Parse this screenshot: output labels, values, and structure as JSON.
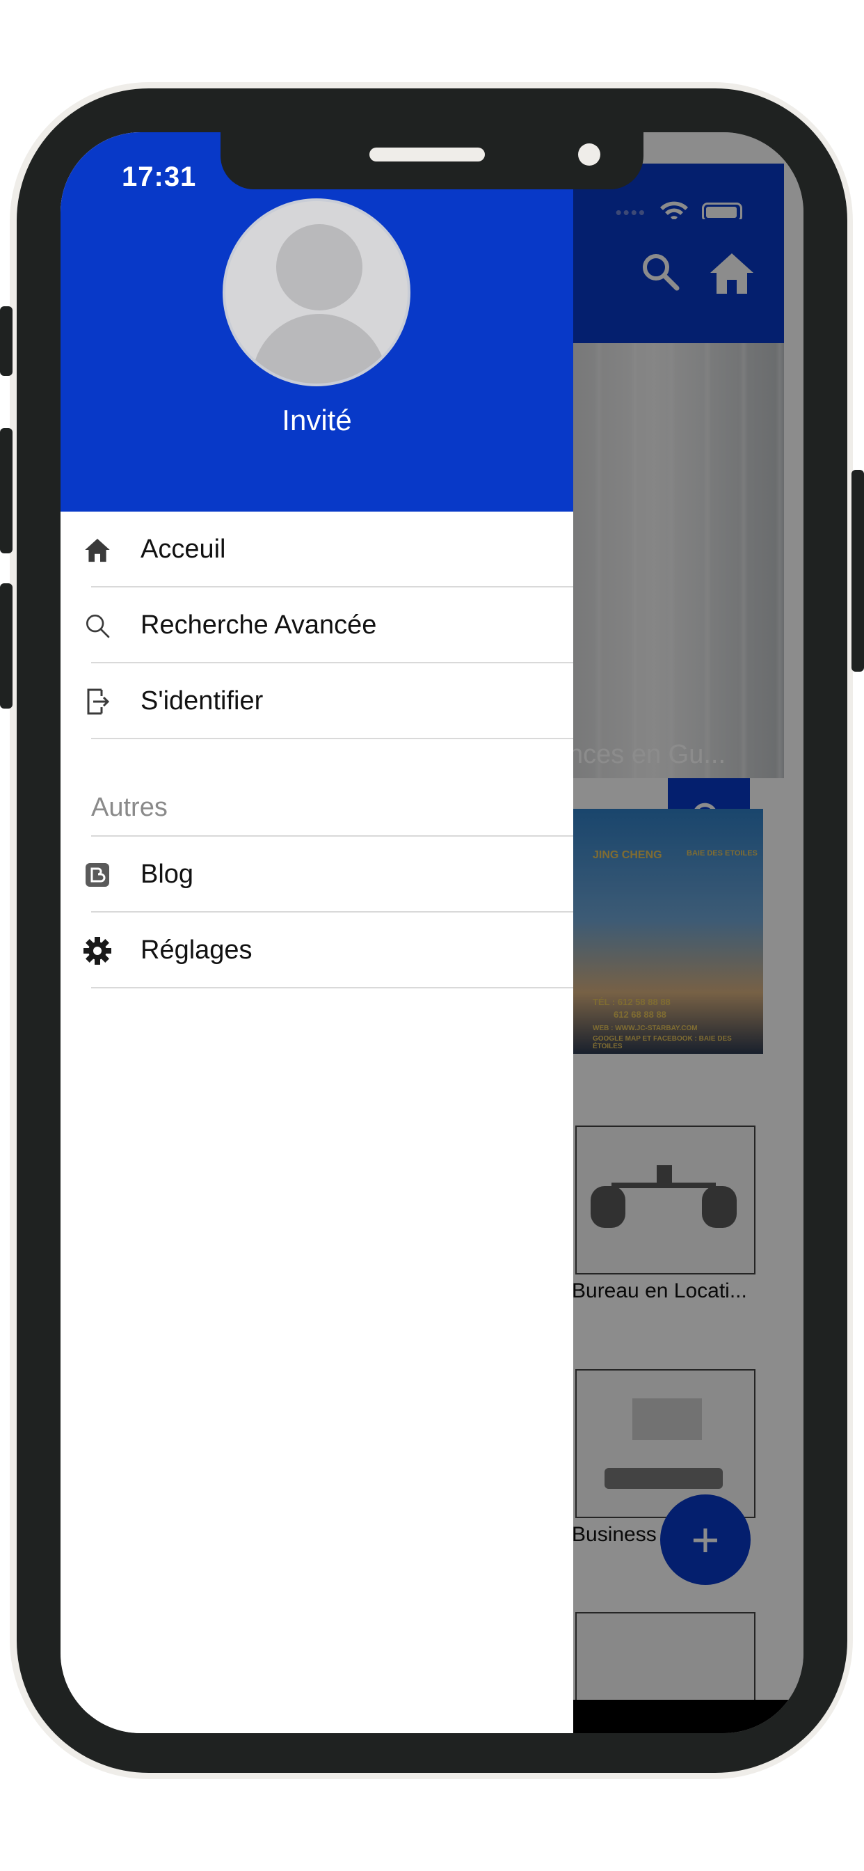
{
  "status_bar": {
    "time": "17:31"
  },
  "drawer": {
    "user_name": "Invité",
    "menu": [
      {
        "label": "Acceuil",
        "icon": "home-icon"
      },
      {
        "label": "Recherche Avancée",
        "icon": "search-icon"
      },
      {
        "label": "S'identifier",
        "icon": "login-icon"
      }
    ],
    "section_title": "Autres",
    "section_items": [
      {
        "label": "Blog",
        "icon": "blog-icon"
      },
      {
        "label": "Réglages",
        "icon": "gear-icon"
      }
    ]
  },
  "background_app": {
    "hero_caption": "nces en Gu...",
    "ad": {
      "brand": "JING CHENG",
      "brand2": "BAIE DES ETOILES",
      "phone1": "TÉL : 612 58 88 88",
      "phone2": "612 68 88 88",
      "web": "WEB : WWW.JC-STARBAY.COM",
      "maps": "GOOGLE MAP ET FACEBOOK : BAIE DES ÉTOILES"
    },
    "cards": [
      {
        "label": "Bureau en Locati..."
      },
      {
        "label": "Business"
      }
    ],
    "fab_label": "+"
  },
  "colors": {
    "primary": "#0839c8",
    "drawer_bg": "#ffffff",
    "divider": "#d9d9d9",
    "section_title": "#8a8a8a",
    "phone_frame": "#1f2221"
  }
}
